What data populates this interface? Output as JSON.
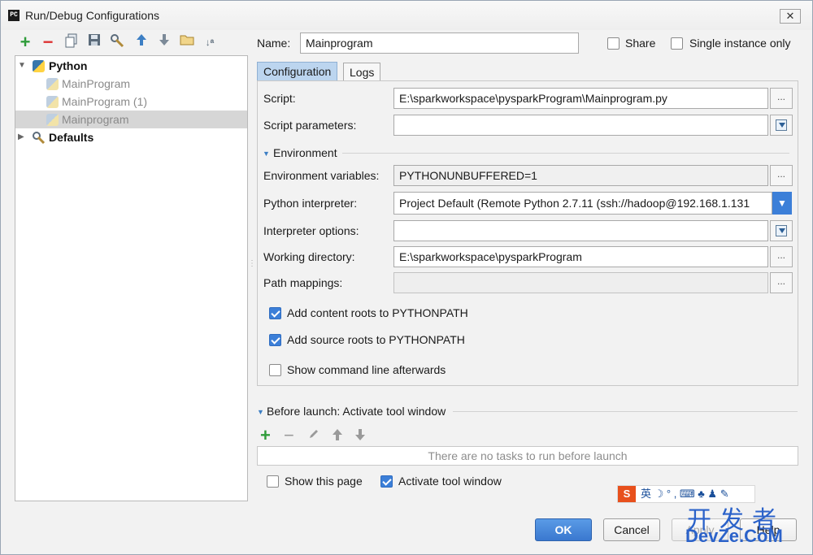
{
  "window": {
    "title": "Run/Debug Configurations",
    "app_icon_text": "PC",
    "close_glyph": "✕"
  },
  "left_toolbar": {
    "icons": [
      "add-icon",
      "remove-icon",
      "copy-icon",
      "save-icon",
      "edit-defaults-icon",
      "move-up-icon",
      "move-down-icon",
      "folder-icon",
      "sort-icon"
    ]
  },
  "tree": {
    "python_label": "Python",
    "items": [
      {
        "label": "MainProgram"
      },
      {
        "label": "MainProgram (1)"
      },
      {
        "label": "Mainprogram"
      }
    ],
    "defaults_label": "Defaults"
  },
  "header": {
    "name_label": "Name:",
    "name_value": "Mainprogram",
    "share_label": "Share",
    "share_checked": false,
    "single_instance_label": "Single instance only",
    "single_instance_checked": false
  },
  "tabs": [
    {
      "label": "Configuration",
      "active": true
    },
    {
      "label": "Logs",
      "active": false
    }
  ],
  "config": {
    "script_label": "Script:",
    "script_value": "E:\\sparkworkspace\\pysparkProgram\\Mainprogram.py",
    "script_params_label": "Script parameters:",
    "script_params_value": "",
    "environment_section": "Environment",
    "env_vars_label": "Environment variables:",
    "env_vars_value": "PYTHONUNBUFFERED=1",
    "interpreter_label": "Python interpreter:",
    "interpreter_value": "Project Default (Remote Python 2.7.11 (ssh://hadoop@192.168.1.131",
    "interpreter_options_label": "Interpreter options:",
    "interpreter_options_value": "",
    "working_dir_label": "Working directory:",
    "working_dir_value": "E:\\sparkworkspace\\pysparkProgram",
    "path_mappings_label": "Path mappings:",
    "path_mappings_value": "",
    "dots": "...",
    "add_content_roots_label": "Add content roots to PYTHONPATH",
    "add_content_roots_checked": true,
    "add_source_roots_label": "Add source roots to PYTHONPATH",
    "add_source_roots_checked": true,
    "show_cmd_label": "Show command line afterwards",
    "show_cmd_checked": false
  },
  "before_launch": {
    "title": "Before launch: Activate tool window",
    "empty_text": "There are no tasks to run before launch",
    "show_page_label": "Show this page",
    "show_page_checked": false,
    "activate_label": "Activate tool window",
    "activate_checked": true
  },
  "buttons": {
    "ok": "OK",
    "cancel": "Cancel",
    "apply": "Apply",
    "help": "Help"
  },
  "overlay": {
    "ime_text": "英 ☽ ° , ⌨ ♣ ♟ ✎",
    "ime_logo": "S",
    "watermark_cn": "开发者",
    "watermark_en": "DevZe.CoM"
  },
  "colors": {
    "accent": "#3c7fd8",
    "add_green": "#2f9c3a",
    "remove_red": "#d33333",
    "selection": "#d6d6d6",
    "tab_active": "#bcd5ef"
  }
}
